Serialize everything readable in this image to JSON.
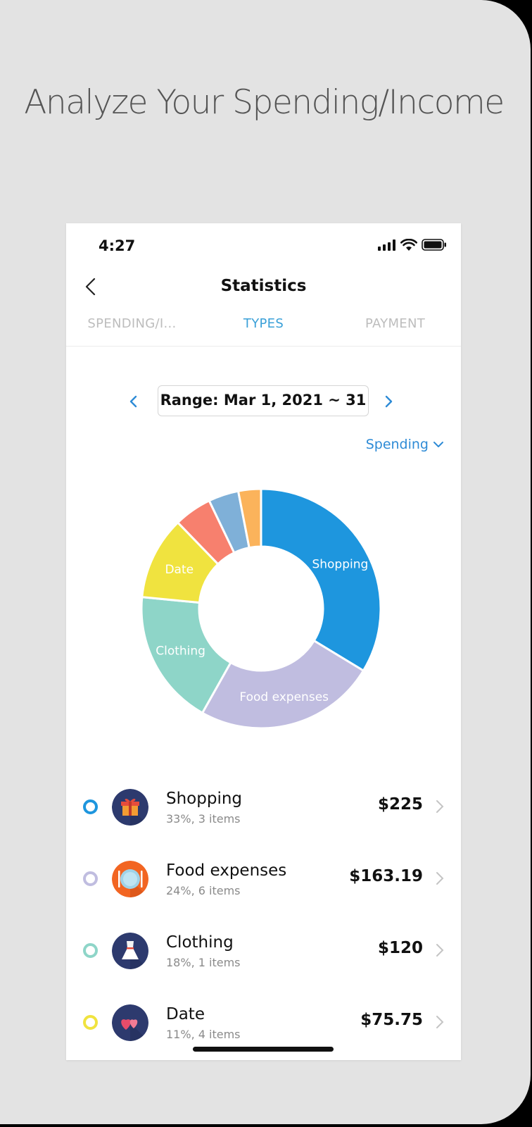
{
  "promo": {
    "headline": "Analyze Your Spending/Income"
  },
  "status_bar": {
    "time": "4:27"
  },
  "header": {
    "title": "Statistics"
  },
  "tabs": [
    {
      "label": "SPENDING/I...",
      "active": false
    },
    {
      "label": "TYPES",
      "active": true
    },
    {
      "label": "PAYMENT",
      "active": false
    }
  ],
  "range": {
    "label": "Range: Mar 1, 2021 ~ 31"
  },
  "filter": {
    "label": "Spending"
  },
  "chart_data": {
    "type": "pie",
    "categories": [
      "Shopping",
      "Food expenses",
      "Clothing",
      "Date",
      "",
      "",
      ""
    ],
    "labels": [
      "Shopping",
      "Food expenses",
      "Clothing",
      "Date"
    ],
    "values": [
      33,
      24,
      18,
      11,
      5,
      4,
      3
    ],
    "colors": [
      "#1e96de",
      "#c0bde0",
      "#8ed5c8",
      "#f0e33f",
      "#f7806e",
      "#7fb0d8",
      "#fbb35b"
    ]
  },
  "items": [
    {
      "name": "Shopping",
      "sub": "33%, 3 items",
      "amount": "$225",
      "ring": "#1e96de",
      "icon": "gift-icon"
    },
    {
      "name": "Food expenses",
      "sub": "24%, 6 items",
      "amount": "$163.19",
      "ring": "#c0bde0",
      "icon": "plate-icon"
    },
    {
      "name": "Clothing",
      "sub": "18%, 1 items",
      "amount": "$120",
      "ring": "#8ed5c8",
      "icon": "dress-icon"
    },
    {
      "name": "Date",
      "sub": "11%, 4 items",
      "amount": "$75.75",
      "ring": "#f0e33f",
      "icon": "hearts-icon"
    }
  ],
  "colors": {
    "accent": "#2e8bd6",
    "tab_active": "#3aa0d8",
    "tab_inactive": "#bdbdbd"
  }
}
